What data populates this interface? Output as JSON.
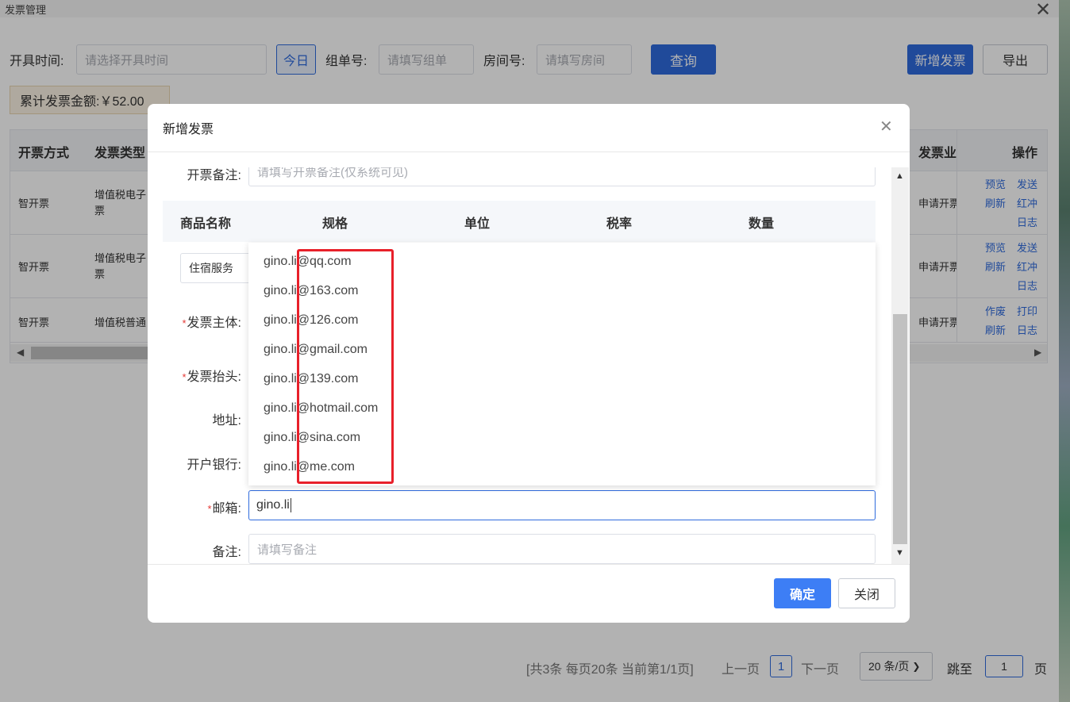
{
  "window": {
    "title": "发票管理"
  },
  "filters": {
    "date_label": "开具时间:",
    "date_placeholder": "请选择开具时间",
    "today_button": "今日",
    "group_label": "组单号:",
    "group_placeholder": "请填写组单",
    "room_label": "房间号:",
    "room_placeholder": "请填写房间",
    "query_button": "查询",
    "new_invoice_button": "新增发票",
    "export_button": "导出"
  },
  "summary": {
    "total_label": "累计发票金额:￥52.00"
  },
  "table": {
    "headers": [
      "开票方式",
      "发票类型",
      "发票业",
      "操作"
    ],
    "rows": [
      {
        "method": "智开票",
        "type": "增值税电子票",
        "biz": "申请开票",
        "actions": [
          "预览",
          "发送",
          "刷新",
          "红冲",
          "日志"
        ]
      },
      {
        "method": "智开票",
        "type": "增值税电子票",
        "biz": "申请开票",
        "actions": [
          "预览",
          "发送",
          "刷新",
          "红冲",
          "日志"
        ]
      },
      {
        "method": "智开票",
        "type": "增值税普通",
        "biz": "申请开票",
        "actions": [
          "作废",
          "打印",
          "刷新",
          "日志"
        ]
      }
    ]
  },
  "pagination": {
    "summary": "[共3条 每页20条 当前第1/1页]",
    "prev": "上一页",
    "current_page": "1",
    "next": "下一页",
    "page_size": "20 条/页",
    "jump_label": "跳至",
    "jump_value": "1",
    "page_suffix": "页"
  },
  "modal": {
    "title": "新增发票",
    "remark_label": "开票备注:",
    "remark_placeholder": "请填写开票备注(仅系统可见)",
    "goods_headers": [
      "商品名称",
      "规格",
      "单位",
      "税率",
      "数量"
    ],
    "goods_row_name": "住宿服务",
    "subject_label": "发票主体:",
    "header_label": "发票抬头:",
    "address_label": "地址:",
    "bank_label": "开户银行:",
    "email_label": "邮箱:",
    "email_value": "gino.li",
    "note_label": "备注:",
    "note_placeholder": "请填写备注",
    "confirm_button": "确定",
    "close_button": "关闭"
  },
  "email_suggestions": [
    "gino.li@qq.com",
    "gino.li@163.com",
    "gino.li@126.com",
    "gino.li@gmail.com",
    "gino.li@139.com",
    "gino.li@hotmail.com",
    "gino.li@sina.com",
    "gino.li@me.com"
  ],
  "colors": {
    "primary": "#2f6bdd",
    "required": "#e53935",
    "highlight": "#e8202a"
  }
}
